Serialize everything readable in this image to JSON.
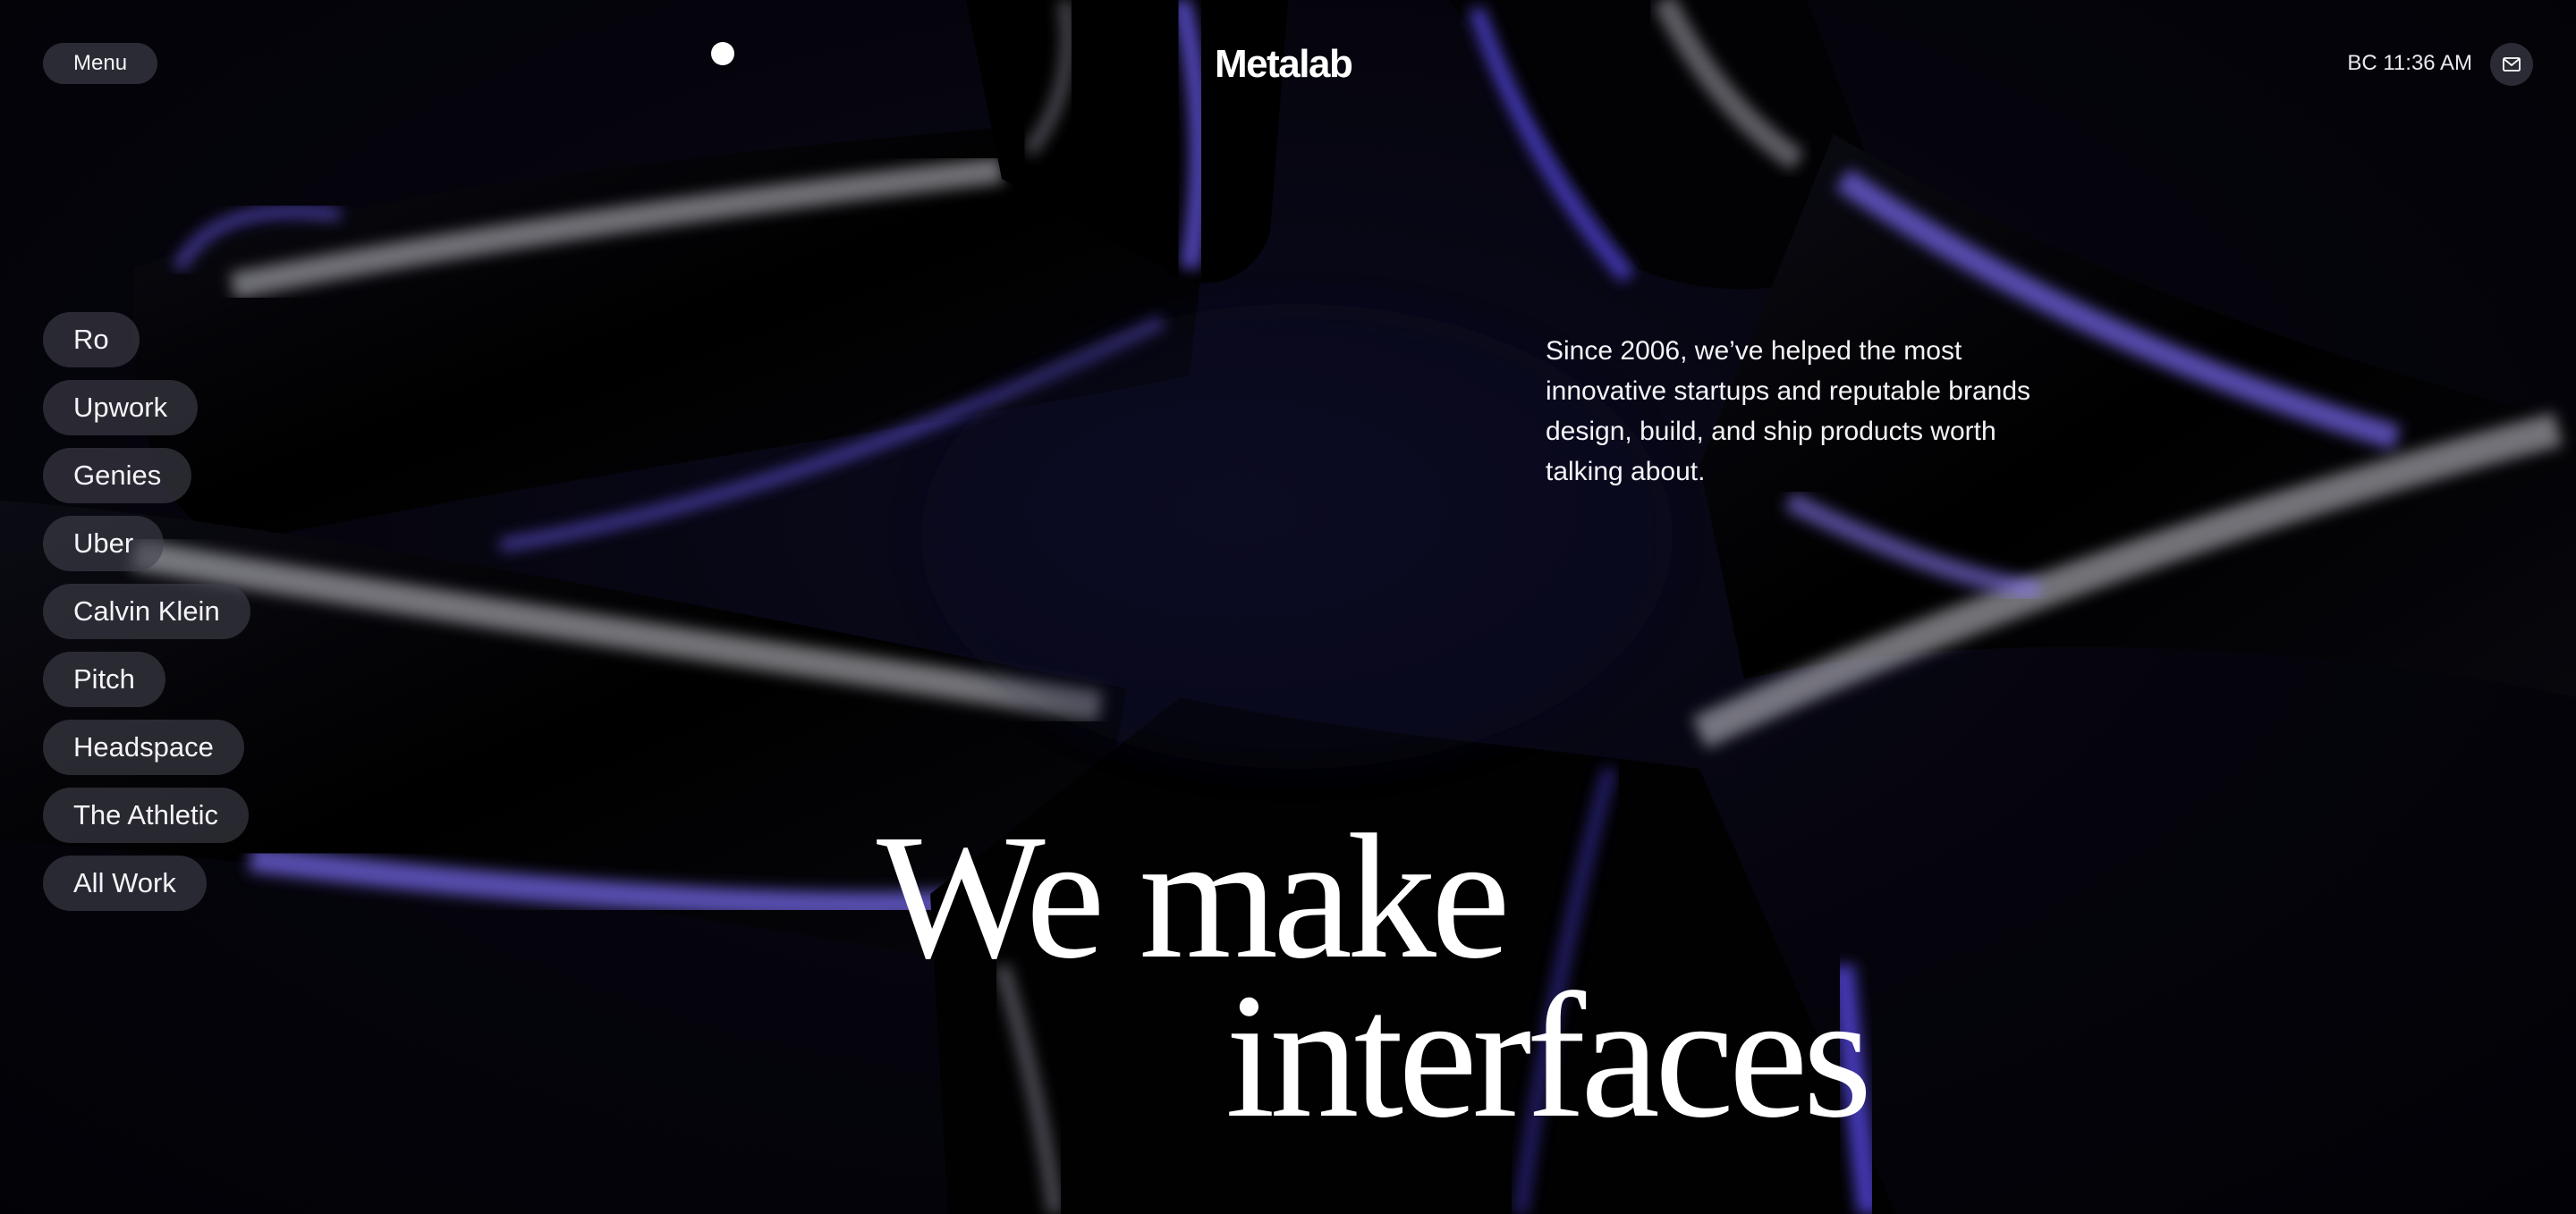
{
  "header": {
    "menu_label": "Menu",
    "logo": "Metalab",
    "clock": "BC 11:36 AM",
    "mail_icon": "mail-icon"
  },
  "clients": [
    {
      "label": "Ro"
    },
    {
      "label": "Upwork"
    },
    {
      "label": "Genies"
    },
    {
      "label": "Uber"
    },
    {
      "label": "Calvin Klein"
    },
    {
      "label": "Pitch"
    },
    {
      "label": "Headspace"
    },
    {
      "label": "The Athletic"
    },
    {
      "label": "All Work"
    }
  ],
  "intro": "Since 2006, we’ve helped the most innovative startups and reputable brands design, build, and ship products worth talking about.",
  "headline": {
    "line1": "We make",
    "line2": "interfaces"
  },
  "colors": {
    "background": "#05040c",
    "accent_purple": "#5b4be0",
    "pill_bg": "#42424e",
    "text": "#ffffff"
  }
}
